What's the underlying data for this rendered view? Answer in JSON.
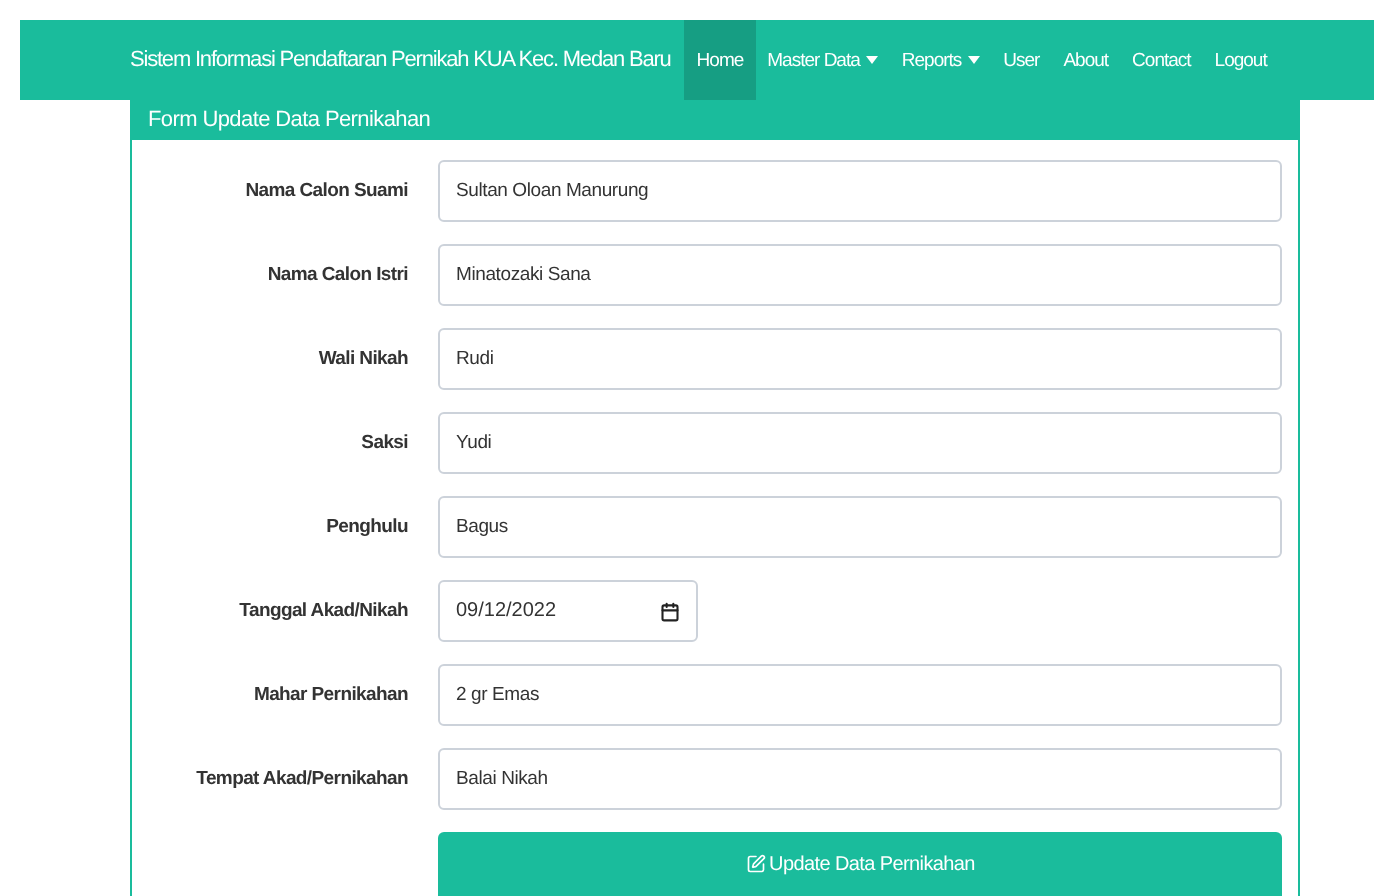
{
  "navbar": {
    "brand": "Sistem Informasi Pendaftaran Pernikah KUA Kec. Medan Baru",
    "items": [
      {
        "label": "Home",
        "selected": true,
        "dropdown": false
      },
      {
        "label": "Master Data",
        "selected": false,
        "dropdown": true
      },
      {
        "label": "Reports",
        "selected": false,
        "dropdown": true
      },
      {
        "label": "User",
        "selected": false,
        "dropdown": false
      },
      {
        "label": "About",
        "selected": false,
        "dropdown": false
      },
      {
        "label": "Contact",
        "selected": false,
        "dropdown": false
      },
      {
        "label": "Logout",
        "selected": false,
        "dropdown": false
      }
    ]
  },
  "panel": {
    "title": "Form Update Data Pernikahan",
    "fields": [
      {
        "label": "Nama Calon Suami",
        "value": "Sultan Oloan Manurung",
        "kind": "text"
      },
      {
        "label": "Nama Calon Istri",
        "value": "Minatozaki Sana",
        "kind": "text"
      },
      {
        "label": "Wali Nikah",
        "value": "Rudi",
        "kind": "text"
      },
      {
        "label": "Saksi",
        "value": "Yudi",
        "kind": "text"
      },
      {
        "label": "Penghulu",
        "value": "Bagus",
        "kind": "text"
      },
      {
        "label": "Tanggal Akad/Nikah",
        "value": "09/12/2022",
        "kind": "date"
      },
      {
        "label": "Mahar Pernikahan",
        "value": "2 gr Emas",
        "kind": "text"
      },
      {
        "label": "Tempat Akad/Pernikahan",
        "value": "Balai Nikah",
        "kind": "text"
      }
    ],
    "submit": "Update Data Pernikahan"
  }
}
